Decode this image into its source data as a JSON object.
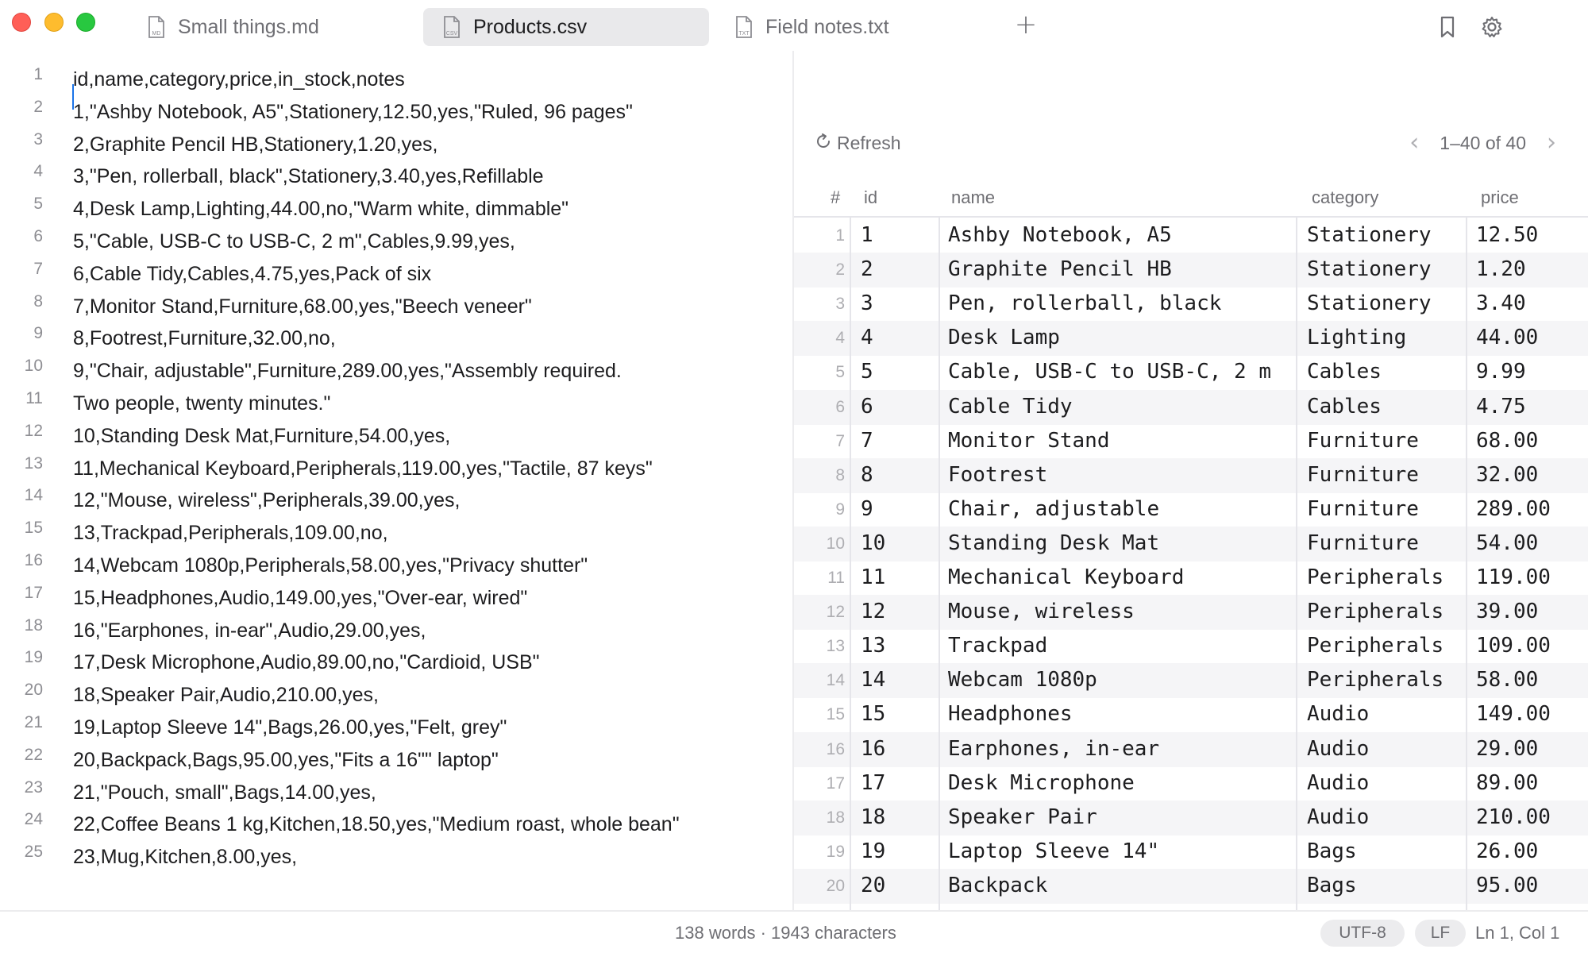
{
  "tabs": [
    {
      "label": "Small things.md",
      "badge": "MD"
    },
    {
      "label": "Products.csv",
      "badge": "CSV"
    },
    {
      "label": "Field notes.txt",
      "badge": "TXT"
    }
  ],
  "active_tab": 1,
  "toolbar": {
    "new_tab_label": "+"
  },
  "editor": {
    "lines": [
      {
        "n": "1",
        "text": "id,name,category,price,in_stock,notes"
      },
      {
        "n": "2",
        "text": "1,\"Ashby Notebook, A5\",Stationery,12.50,yes,\"Ruled, 96 pages\""
      },
      {
        "n": "3",
        "text": "2,Graphite Pencil HB,Stationery,1.20,yes,"
      },
      {
        "n": "4",
        "text": "3,\"Pen, rollerball, black\",Stationery,3.40,yes,Refillable"
      },
      {
        "n": "5",
        "text": "4,Desk Lamp,Lighting,44.00,no,\"Warm white, dimmable\""
      },
      {
        "n": "6",
        "text": "5,\"Cable, USB-C to USB-C, 2 m\",Cables,9.99,yes,"
      },
      {
        "n": "7",
        "text": "6,Cable Tidy,Cables,4.75,yes,Pack of six"
      },
      {
        "n": "8",
        "text": "7,Monitor Stand,Furniture,68.00,yes,\"Beech veneer\""
      },
      {
        "n": "9",
        "text": "8,Footrest,Furniture,32.00,no,"
      },
      {
        "n": "10",
        "text": "9,\"Chair, adjustable\",Furniture,289.00,yes,\"Assembly required."
      },
      {
        "n": "11",
        "text": "Two people, twenty minutes.\""
      },
      {
        "n": "12",
        "text": "10,Standing Desk Mat,Furniture,54.00,yes,"
      },
      {
        "n": "13",
        "text": "11,Mechanical Keyboard,Peripherals,119.00,yes,\"Tactile, 87 keys\""
      },
      {
        "n": "14",
        "text": "12,\"Mouse, wireless\",Peripherals,39.00,yes,"
      },
      {
        "n": "15",
        "text": "13,Trackpad,Peripherals,109.00,no,"
      },
      {
        "n": "16",
        "text": "14,Webcam 1080p,Peripherals,58.00,yes,\"Privacy shutter\""
      },
      {
        "n": "17",
        "text": "15,Headphones,Audio,149.00,yes,\"Over-ear, wired\""
      },
      {
        "n": "18",
        "text": "16,\"Earphones, in-ear\",Audio,29.00,yes,"
      },
      {
        "n": "19",
        "text": "17,Desk Microphone,Audio,89.00,no,\"Cardioid, USB\""
      },
      {
        "n": "20",
        "text": "18,Speaker Pair,Audio,210.00,yes,"
      },
      {
        "n": "21",
        "text": "19,Laptop Sleeve 14\",Bags,26.00,yes,\"Felt, grey\""
      },
      {
        "n": "22",
        "text": "20,Backpack,Bags,95.00,yes,\"Fits a 16\"\" laptop\""
      },
      {
        "n": "23",
        "text": "21,\"Pouch, small\",Bags,14.00,yes,"
      },
      {
        "n": "24",
        "text": "22,Coffee Beans 1 kg,Kitchen,18.50,yes,\"Medium roast, whole bean\""
      },
      {
        "n": "25",
        "text": "23,Mug,Kitchen,8.00,yes,"
      }
    ]
  },
  "grid": {
    "refresh_label": "Refresh",
    "pager_label": "1–40 of 40",
    "headers": [
      "#",
      "id",
      "name",
      "category",
      "price"
    ],
    "rows": [
      [
        "1",
        "1",
        "Ashby Notebook, A5",
        "Stationery",
        "12.50"
      ],
      [
        "2",
        "2",
        "Graphite Pencil HB",
        "Stationery",
        "1.20"
      ],
      [
        "3",
        "3",
        "Pen, rollerball, black",
        "Stationery",
        "3.40"
      ],
      [
        "4",
        "4",
        "Desk Lamp",
        "Lighting",
        "44.00"
      ],
      [
        "5",
        "5",
        "Cable, USB-C to USB-C, 2 m",
        "Cables",
        "9.99"
      ],
      [
        "6",
        "6",
        "Cable Tidy",
        "Cables",
        "4.75"
      ],
      [
        "7",
        "7",
        "Monitor Stand",
        "Furniture",
        "68.00"
      ],
      [
        "8",
        "8",
        "Footrest",
        "Furniture",
        "32.00"
      ],
      [
        "9",
        "9",
        "Chair, adjustable",
        "Furniture",
        "289.00"
      ],
      [
        "10",
        "10",
        "Standing Desk Mat",
        "Furniture",
        "54.00"
      ],
      [
        "11",
        "11",
        "Mechanical Keyboard",
        "Peripherals",
        "119.00"
      ],
      [
        "12",
        "12",
        "Mouse, wireless",
        "Peripherals",
        "39.00"
      ],
      [
        "13",
        "13",
        "Trackpad",
        "Peripherals",
        "109.00"
      ],
      [
        "14",
        "14",
        "Webcam 1080p",
        "Peripherals",
        "58.00"
      ],
      [
        "15",
        "15",
        "Headphones",
        "Audio",
        "149.00"
      ],
      [
        "16",
        "16",
        "Earphones, in-ear",
        "Audio",
        "29.00"
      ],
      [
        "17",
        "17",
        "Desk Microphone",
        "Audio",
        "89.00"
      ],
      [
        "18",
        "18",
        "Speaker Pair",
        "Audio",
        "210.00"
      ],
      [
        "19",
        "19",
        "Laptop Sleeve 14\"",
        "Bags",
        "26.00"
      ],
      [
        "20",
        "20",
        "Backpack",
        "Bags",
        "95.00"
      ]
    ]
  },
  "status": {
    "counts": "138 words · 1943 characters",
    "encoding": "UTF-8",
    "line_ending": "LF",
    "cursor": "Ln 1, Col 1"
  },
  "icons": {
    "file": "document-icon",
    "bookmark": "bookmark-icon",
    "settings": "gear-icon",
    "refresh": "refresh-icon",
    "prev": "chevron-left-icon",
    "next": "chevron-right-icon"
  },
  "colors": {
    "close": "#ff5f57",
    "minimize": "#febc2e",
    "maximize": "#28c840",
    "caret": "#1a73e8",
    "alt_row": "#f5f5f7"
  }
}
